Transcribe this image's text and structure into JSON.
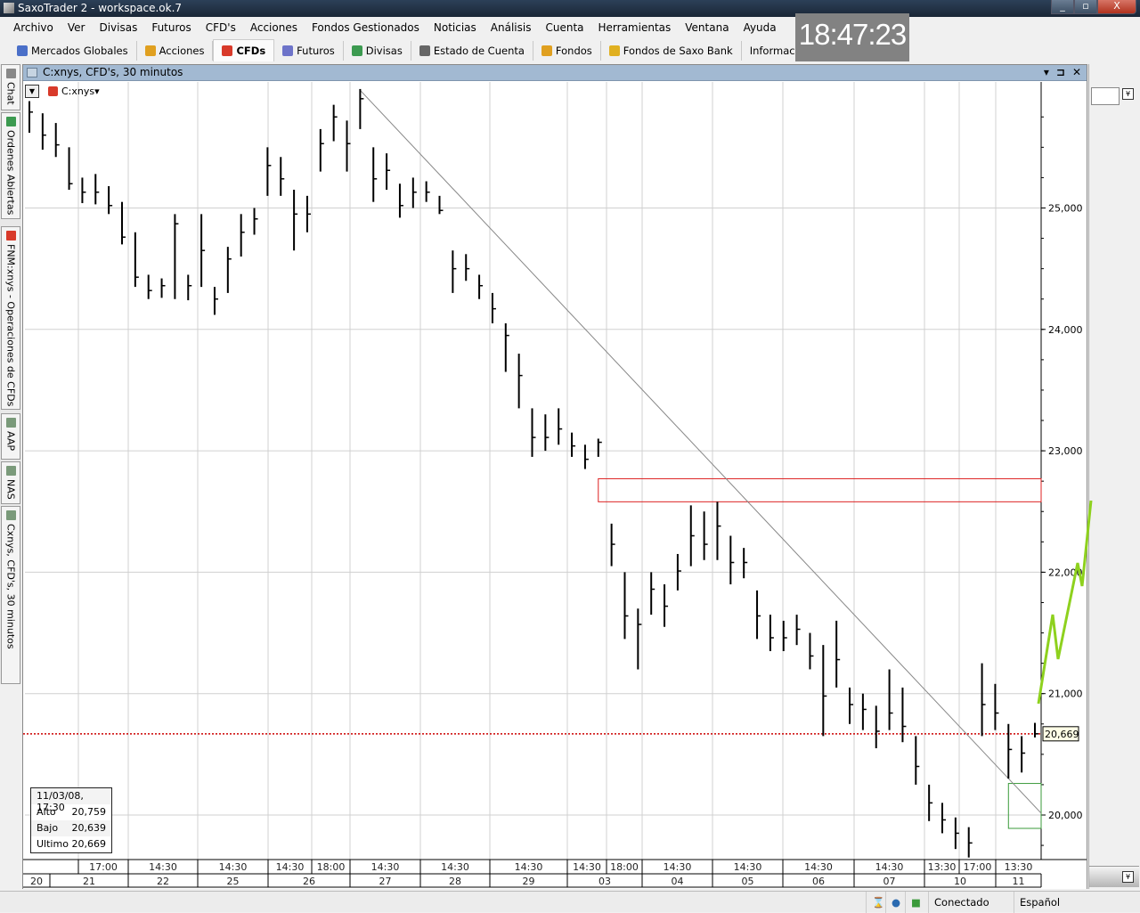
{
  "window": {
    "title": "SaxoTrader 2 - workspace.ok.7",
    "minimize": "_",
    "maximize": "▫",
    "close": "X"
  },
  "menu": [
    "Archivo",
    "Ver",
    "Divisas",
    "Futuros",
    "CFD's",
    "Acciones",
    "Fondos Gestionados",
    "Noticias",
    "Análisis",
    "Cuenta",
    "Herramientas",
    "Ventana",
    "Ayuda"
  ],
  "toolbar": [
    {
      "label": "Mercados Globales",
      "icon": "gear-icon",
      "color": "#4a6fc8"
    },
    {
      "label": "Acciones",
      "icon": "acciones-icon",
      "color": "#e0a020"
    },
    {
      "label": "CFDs",
      "icon": "cfd-icon",
      "color": "#d83a2a",
      "active": true
    },
    {
      "label": "Futuros",
      "icon": "futuros-icon",
      "color": "#6d73c9"
    },
    {
      "label": "Divisas",
      "icon": "divisas-icon",
      "color": "#3c9a50"
    },
    {
      "label": "Estado de Cuenta",
      "icon": "account-icon",
      "color": "#666666"
    },
    {
      "label": "Fondos",
      "icon": "fondos-icon",
      "color": "#e0a020"
    },
    {
      "label": "Fondos de Saxo Bank",
      "icon": "saxo-funds-icon",
      "color": "#e0b020"
    },
    {
      "label": "Información",
      "icon": "",
      "color": ""
    }
  ],
  "clock": "18:47:23",
  "sidebar_tabs": [
    {
      "label": "Chat",
      "color": "#888888"
    },
    {
      "label": "Ordenes Abiertas",
      "color": "#3c9a50"
    },
    {
      "label": "FNM:xnys - Operaciones de CFDs",
      "color": "#d83a2a"
    },
    {
      "label": "AAP",
      "color": "#7a9a7a"
    },
    {
      "label": "NAS",
      "color": "#7a9a7a"
    },
    {
      "label": "Cxnys, CFD's, 30 minutos",
      "color": "#7a9a7a"
    }
  ],
  "chart_window": {
    "title": "C:xnys, CFD's, 30 minutos",
    "symbol": "C:xnys"
  },
  "infobox": {
    "datetime": "11/03/08, 17:30",
    "rows": [
      {
        "label": "Alto",
        "value": "20,759"
      },
      {
        "label": "Bajo",
        "value": "20,639"
      },
      {
        "label": "Ultimo",
        "value": "20,669"
      }
    ]
  },
  "status": {
    "connection": "Conectado",
    "language": "Español"
  },
  "colors": {
    "last_price_line": "#cc0000",
    "resistance_box": "#dd2222",
    "target_box": "#3a9a3a",
    "annotation": "#8ed11e"
  },
  "chart_data": {
    "type": "ohlc",
    "title": "C:xnys, CFD's, 30 minutos",
    "ylim": [
      19650,
      26050
    ],
    "y_ticks": [
      {
        "v": 20000,
        "label": "20,000"
      },
      {
        "v": 21000,
        "label": "21,000"
      },
      {
        "v": 22000,
        "label": "22,000"
      },
      {
        "v": 23000,
        "label": "23,000"
      },
      {
        "v": 24000,
        "label": "24,000"
      },
      {
        "v": 25000,
        "label": "25,000"
      }
    ],
    "last_price": {
      "value": 20669,
      "label": "20,669"
    },
    "time_labels": [
      "17:00",
      "14:30",
      "14:30",
      "14:30",
      "18:00",
      "14:30",
      "14:30",
      "14:30",
      "14:30",
      "18:00",
      "14:30",
      "14:30",
      "14:30",
      "14:30",
      "13:30",
      "17:00",
      "13:30"
    ],
    "date_labels": [
      "20",
      "21",
      "22",
      "25",
      "26",
      "27",
      "28",
      "29",
      "03",
      "04",
      "05",
      "06",
      "07",
      "10",
      "11"
    ],
    "bars_hlc": [
      [
        25880,
        25620,
        25790
      ],
      [
        25780,
        25480,
        25600
      ],
      [
        25700,
        25420,
        25520
      ],
      [
        25500,
        25150,
        25200
      ],
      [
        25250,
        25040,
        25130
      ],
      [
        25280,
        25030,
        25130
      ],
      [
        25180,
        24950,
        25020
      ],
      [
        25050,
        24700,
        24760
      ],
      [
        24800,
        24350,
        24430
      ],
      [
        24450,
        24250,
        24320
      ],
      [
        24420,
        24260,
        24360
      ],
      [
        24950,
        24250,
        24870
      ],
      [
        24450,
        24240,
        24360
      ],
      [
        24950,
        24350,
        24650
      ],
      [
        24350,
        24120,
        24250
      ],
      [
        24680,
        24300,
        24580
      ],
      [
        24950,
        24600,
        24800
      ],
      [
        25000,
        24780,
        24910
      ],
      [
        25500,
        25100,
        25350
      ],
      [
        25420,
        25100,
        25240
      ],
      [
        25150,
        24650,
        24950
      ],
      [
        25100,
        24800,
        24950
      ],
      [
        25650,
        25300,
        25530
      ],
      [
        25850,
        25550,
        25750
      ],
      [
        25720,
        25300,
        25530
      ],
      [
        25980,
        25650,
        25900
      ],
      [
        25500,
        25050,
        25240
      ],
      [
        25450,
        25150,
        25310
      ],
      [
        25200,
        24920,
        25020
      ],
      [
        25250,
        25000,
        25130
      ],
      [
        25220,
        25050,
        25130
      ],
      [
        25100,
        24950,
        24980
      ],
      [
        24650,
        24300,
        24500
      ],
      [
        24620,
        24400,
        24500
      ],
      [
        24450,
        24250,
        24360
      ],
      [
        24300,
        24050,
        24170
      ],
      [
        24050,
        23650,
        23950
      ],
      [
        23800,
        23350,
        23620
      ],
      [
        23350,
        22950,
        23110
      ],
      [
        23300,
        23000,
        23110
      ],
      [
        23350,
        23050,
        23180
      ],
      [
        23150,
        22950,
        23040
      ],
      [
        23050,
        22850,
        22930
      ],
      [
        23100,
        22950,
        23070
      ],
      [
        22400,
        22050,
        22230
      ],
      [
        22000,
        21450,
        21640
      ],
      [
        21700,
        21200,
        21570
      ],
      [
        22000,
        21650,
        21860
      ],
      [
        21900,
        21550,
        21720
      ],
      [
        22150,
        21850,
        22010
      ],
      [
        22550,
        22050,
        22300
      ],
      [
        22500,
        22100,
        22230
      ],
      [
        22580,
        22100,
        22380
      ],
      [
        22300,
        21900,
        22080
      ],
      [
        22200,
        21950,
        22080
      ],
      [
        21850,
        21450,
        21640
      ],
      [
        21650,
        21350,
        21460
      ],
      [
        21600,
        21350,
        21460
      ],
      [
        21650,
        21400,
        21530
      ],
      [
        21500,
        21200,
        21310
      ],
      [
        21400,
        20650,
        20980
      ],
      [
        21600,
        21050,
        21280
      ],
      [
        21050,
        20750,
        20910
      ],
      [
        21000,
        20700,
        20870
      ],
      [
        20900,
        20550,
        20690
      ],
      [
        21200,
        20700,
        20840
      ],
      [
        21050,
        20600,
        20730
      ],
      [
        20650,
        20250,
        20400
      ],
      [
        20250,
        19950,
        20100
      ],
      [
        20100,
        19850,
        19960
      ],
      [
        19980,
        19720,
        19850
      ],
      [
        19900,
        19650,
        19770
      ],
      [
        21250,
        20650,
        20910
      ],
      [
        21080,
        20700,
        20840
      ],
      [
        20750,
        20300,
        20540
      ],
      [
        20650,
        20350,
        20510
      ],
      [
        20759,
        20639,
        20669
      ]
    ],
    "trendline": [
      {
        "bar": 25,
        "value": 25970
      },
      {
        "bar": "end",
        "value": 20015
      }
    ],
    "resistance_zone": {
      "from_bar": 43,
      "low": 22580,
      "high": 22770
    },
    "target_zone": {
      "from_bar": 74,
      "low": 19890,
      "high": 20260
    }
  }
}
